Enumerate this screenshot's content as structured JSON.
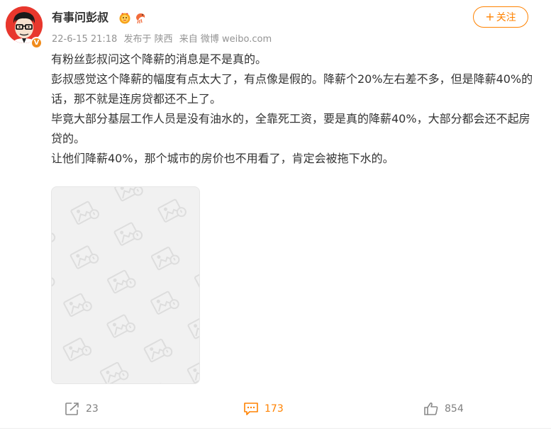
{
  "post": {
    "author": {
      "name": "有事问彭叔",
      "verified_badge": "V",
      "avatar_icon": "cartoon-man-avatar"
    },
    "badge_icons": [
      "lion-mascot-badge-icon",
      "shrimp-badge-icon"
    ],
    "meta": {
      "time": "22-6-15 21:18",
      "location": "发布于 陕西",
      "source": "来自 微博 weibo.com"
    },
    "follow_label": "关注",
    "follow_plus": "+",
    "paragraphs": [
      "有粉丝彭叔问这个降薪的消息是不是真的。",
      "彭叔感觉这个降薪的幅度有点太大了，有点像是假的。降薪个20%左右差不多，但是降薪40%的话，那不就是连房贷都还不上了。",
      "毕竟大部分基层工作人员是没有油水的，全靠死工资，要是真的降薪40%，大部分都会还不起房贷的。",
      "让他们降薪40%，那个城市的房价也不用看了，肯定会被拖下水的。"
    ],
    "image_placeholder_icon": "image-loading-placeholder-icon"
  },
  "actions": {
    "repost_count": "23",
    "comment_count": "173",
    "like_count": "854"
  },
  "colors": {
    "accent": "#ff8200",
    "meta_text": "#939393",
    "body_text": "#333333",
    "avatar_bg": "#e8372d",
    "placeholder_bg": "#f1f1f1"
  }
}
